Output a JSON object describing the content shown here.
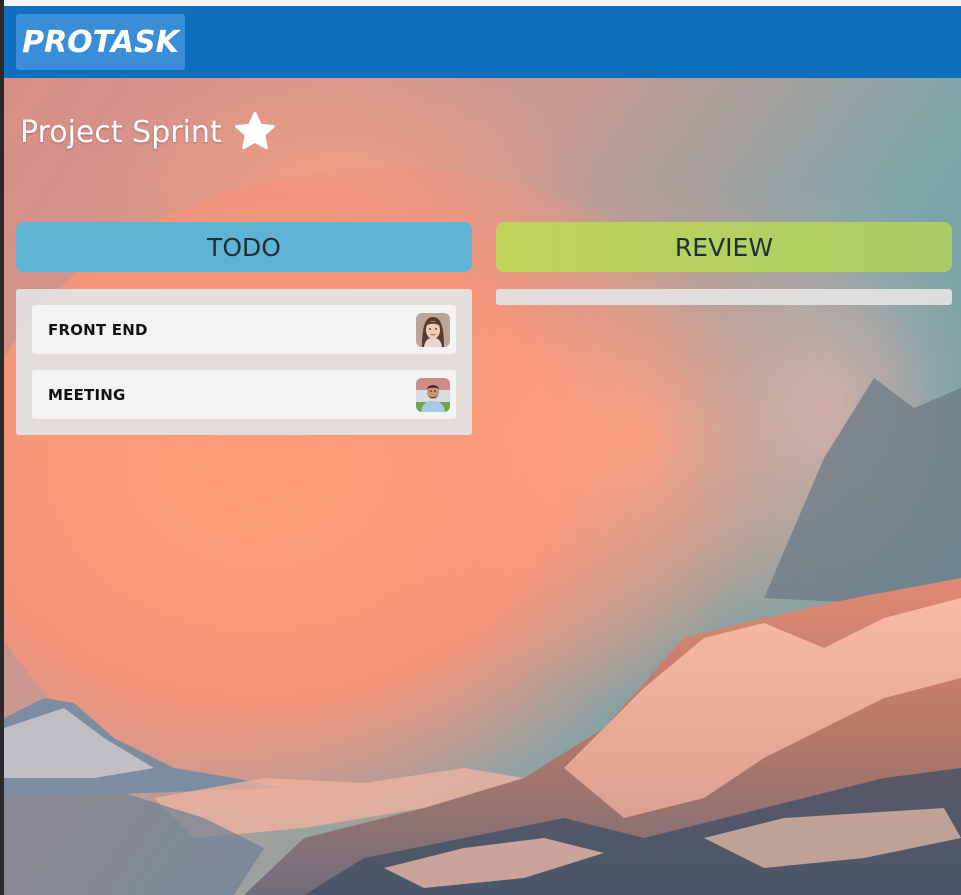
{
  "app": {
    "logo_text": "PROTASK"
  },
  "board": {
    "title": "Project Sprint",
    "starred_icon": "star-icon"
  },
  "columns": [
    {
      "title": "TODO",
      "color": "#5fb4d6",
      "cards": [
        {
          "title": "FRONT END",
          "avatar": "woman-avatar"
        },
        {
          "title": "MEETING",
          "avatar": "man-avatar"
        }
      ]
    },
    {
      "title": "REVIEW",
      "color": "#b8d05e",
      "cards": []
    }
  ],
  "colors": {
    "header": "#0f6fbd",
    "logo_bg": "#3a8ed8",
    "column_body": "#e2e0e0"
  }
}
